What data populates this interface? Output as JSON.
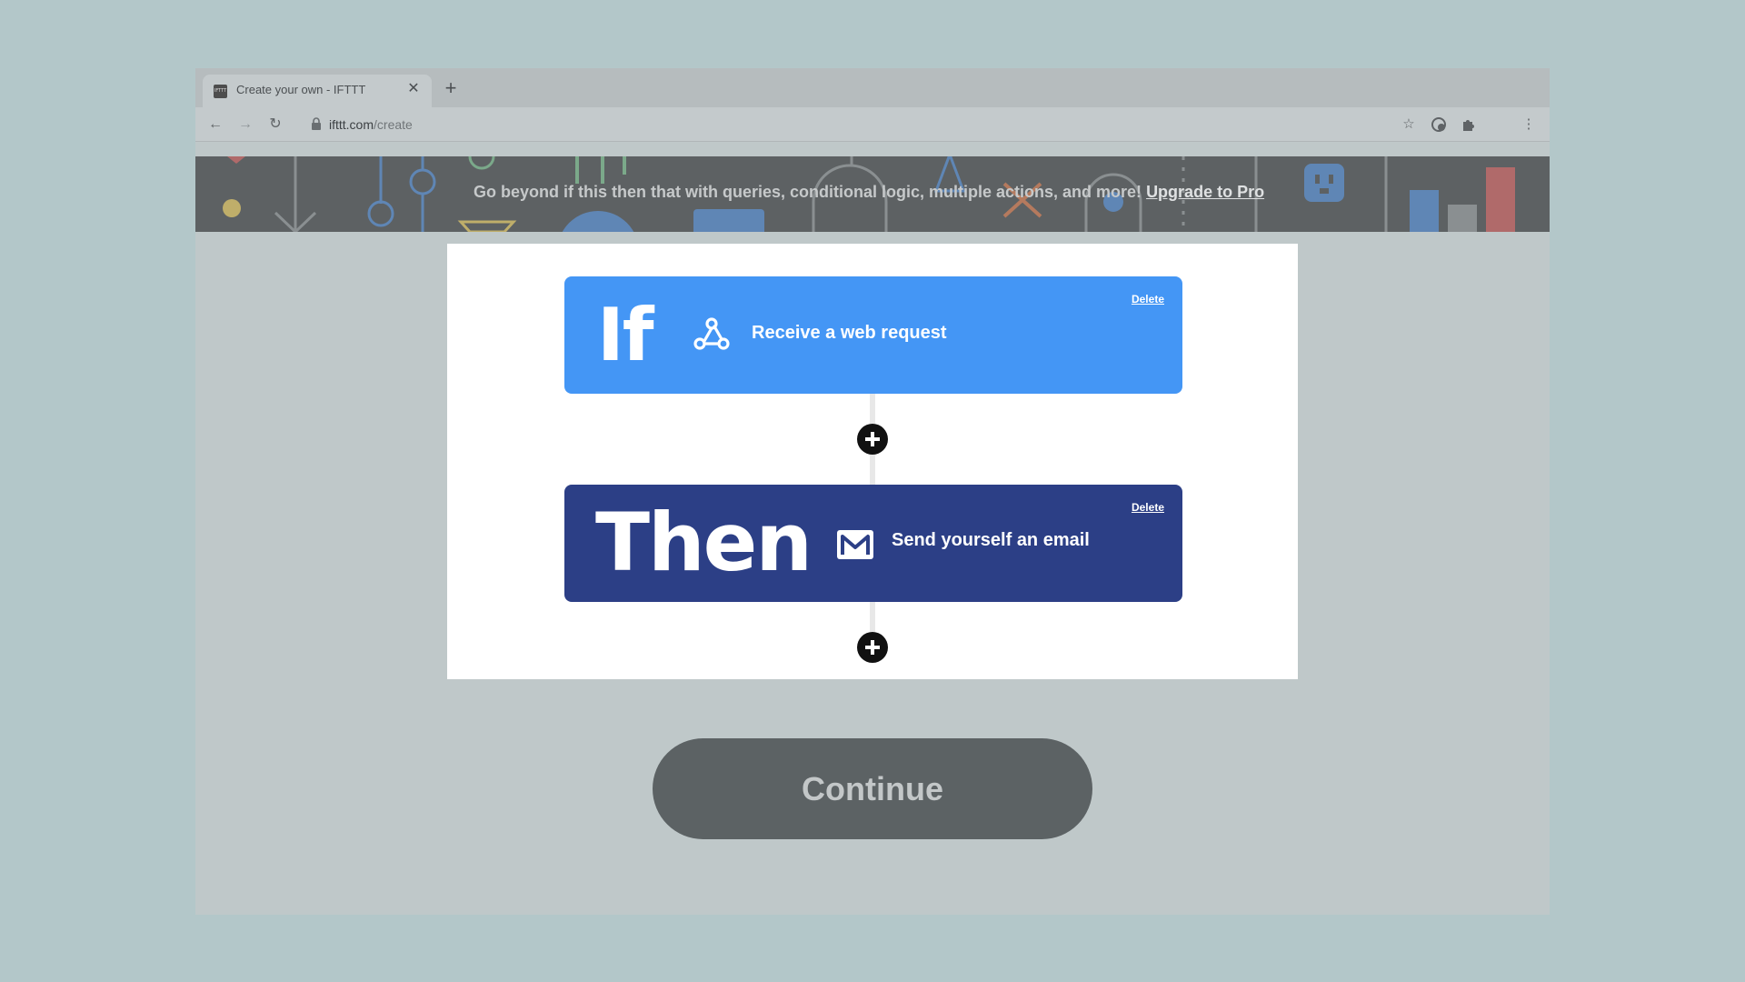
{
  "browser": {
    "tab_title": "Create your own - IFTTT",
    "tab_favicon_text": "IFTTT",
    "url_domain": "ifttt.com",
    "url_path": "/create"
  },
  "banner": {
    "text": "Go beyond if this then that with queries, conditional logic, multiple actions, and more! ",
    "link": "Upgrade to Pro"
  },
  "applet": {
    "if_keyword": "If",
    "if_service_label": "Receive a web request",
    "if_delete": "Delete",
    "then_keyword": "Then",
    "then_service_label": "Send yourself an email",
    "then_delete": "Delete"
  },
  "continue_label": "Continue",
  "colors": {
    "if_block": "#4496f5",
    "then_block": "#2c3f86",
    "page_bg": "#b3c7c9",
    "continue_bg": "#5c6264"
  }
}
